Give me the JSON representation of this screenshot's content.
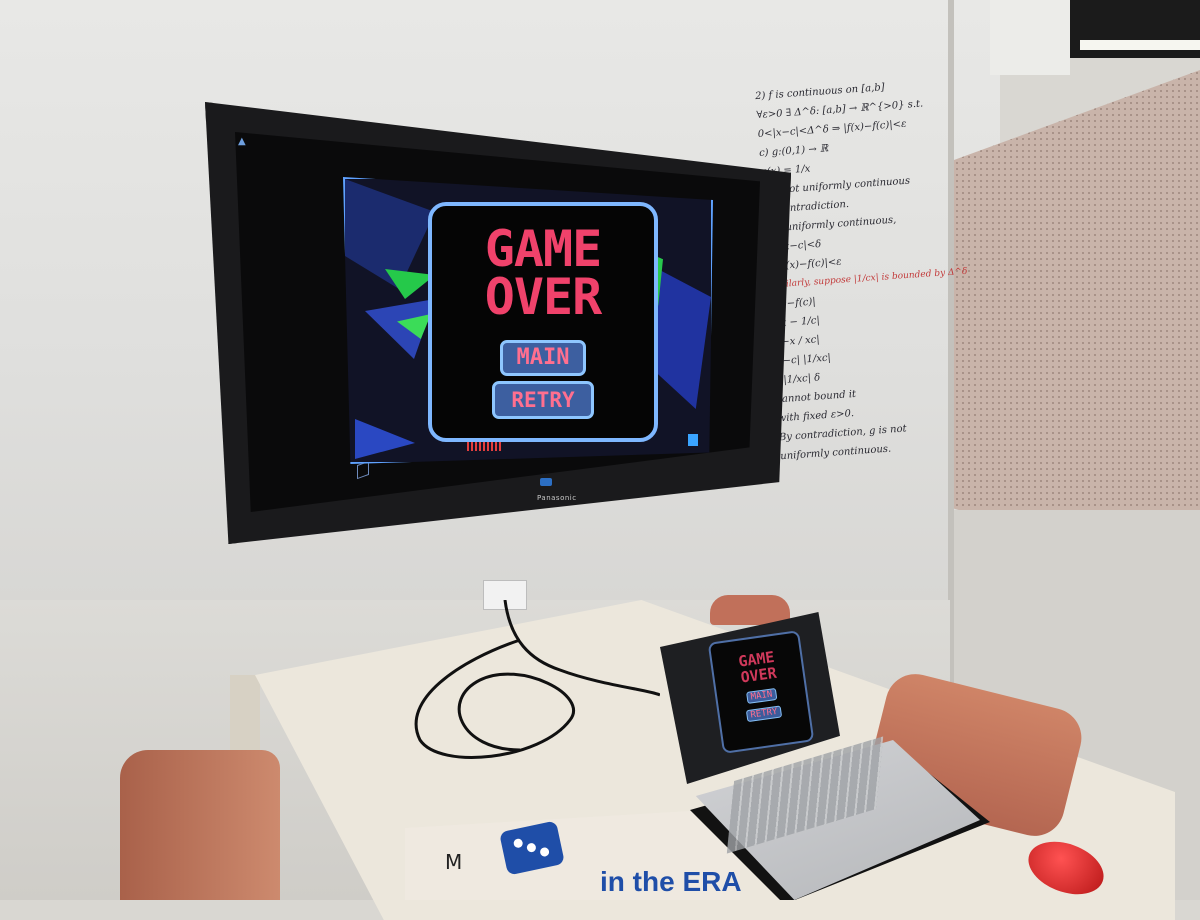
{
  "tv": {
    "brand": "Panasonic",
    "game": {
      "title_line1": "GAME",
      "title_line2": "OVER",
      "main_button": "MAIN",
      "retry_button": "RETRY"
    }
  },
  "laptop": {
    "title_line1": "GAME",
    "title_line2": "OVER",
    "main_button": "MAIN",
    "retry_button": "RETRY"
  },
  "whiteboard": {
    "lines": [
      "2) f is continuous on [a,b]",
      "∀ε>0 ∃ Δ^δ: [a,b] → ℝ^{>0} s.t.",
      "0<|x−c|<Δ^δ ⇒ |f(x)−f(c)|<ε",
      "c) g:(0,1) → ℝ",
      "g(x) = 1/x",
      "g is not uniformly continuous",
      "by contradiction.",
      "g is uniformly continuous,",
      "0<|x−c|<δ",
      "⇒ |f(x)−f(c)|<ε",
      "f(x)−f(c)|",
      "1/x − 1/c|",
      "|c−x / xc|",
      "|x−c| |1/xc|",
      "<|1/xc| δ",
      "cannot bound it",
      "with fixed ε>0.",
      "By contradiction, g is not",
      "uniformly continuous."
    ],
    "red_note": "Similarly, suppose |1/cx| is bounded by Δ^δ"
  },
  "pizza_box": {
    "handwriting": "M",
    "brand_text": "in the ERA"
  }
}
